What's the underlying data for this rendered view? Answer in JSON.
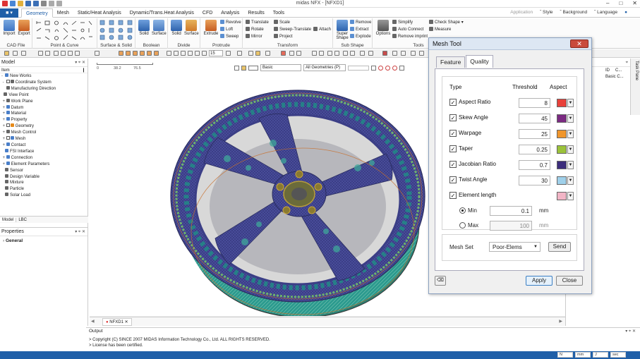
{
  "app": {
    "title": "midas NFX - [NFXD1]"
  },
  "menu": {
    "file_label": "■ ▾",
    "tabs": [
      "Geometry",
      "Mesh",
      "Static/Heat Analysis",
      "Dynamic/Trans.Heat Analysis",
      "CFD",
      "Analysis",
      "Results",
      "Tools"
    ],
    "right": [
      "Application",
      "ˇ Style",
      "ˇ Background",
      "ˇ Language",
      "ˇ"
    ]
  },
  "ribbon": {
    "groups": [
      {
        "label": "CAD File",
        "buttons": [
          "Import",
          "Export"
        ]
      },
      {
        "label": "Point & Curve",
        "buttons": []
      },
      {
        "label": "Surface & Solid",
        "buttons": []
      },
      {
        "label": "Boolean",
        "buttons": [
          "Solid",
          "Surface"
        ]
      },
      {
        "label": "Divide",
        "buttons": [
          "Solid",
          "Surface"
        ]
      },
      {
        "label": "Protrude",
        "buttons": [
          "Extrude"
        ],
        "small": [
          "Revolve",
          "Loft",
          "Sweep"
        ]
      },
      {
        "label": "Transform",
        "small": [
          "Translate",
          "Rotate",
          "Mirror",
          "Scale",
          "Sweep-Translate",
          "Project",
          "Attach"
        ]
      },
      {
        "label": "Sub Shape",
        "buttons": [
          "Super Shape"
        ],
        "small": [
          "Remove",
          "Extract",
          "Explode"
        ]
      },
      {
        "label": "Tools",
        "buttons": [
          "Options"
        ],
        "small": [
          "Simplify",
          "Auto Connect",
          "Remove imprint",
          "Check Shape ▾",
          "Measure"
        ]
      }
    ]
  },
  "toolbar2": {
    "zoom_value": "15"
  },
  "left_panel": {
    "title": "Model",
    "column": "Item",
    "tree": [
      {
        "label": "New Works",
        "color": "#4a7fc9"
      },
      {
        "label": "Coordinate System",
        "color": "#666"
      },
      {
        "label": "Manufacturing Direction",
        "color": "#666"
      },
      {
        "label": "View Point",
        "color": "#666"
      },
      {
        "label": "Work Plane",
        "color": "#666"
      },
      {
        "label": "Datum",
        "color": "#4a7fc9"
      },
      {
        "label": "Material",
        "color": "#4a7fc9"
      },
      {
        "label": "Property",
        "color": "#4a7fc9"
      },
      {
        "label": "Geometry",
        "color": "#e68a1a"
      },
      {
        "label": "Mesh Control",
        "color": "#666"
      },
      {
        "label": "Mesh",
        "color": "#4a7fc9"
      },
      {
        "label": "Contact",
        "color": "#4a7fc9"
      },
      {
        "label": "FSI Interface",
        "color": "#4a7fc9"
      },
      {
        "label": "Connection",
        "color": "#4a7fc9"
      },
      {
        "label": "Element Parameters",
        "color": "#4a7fc9"
      },
      {
        "label": "Sensor",
        "color": "#666"
      },
      {
        "label": "Design Variable",
        "color": "#666"
      },
      {
        "label": "Mixture",
        "color": "#666"
      },
      {
        "label": "Particle",
        "color": "#666"
      },
      {
        "label": "Solar Load",
        "color": "#666"
      }
    ],
    "tabs": [
      "Model",
      "LBC"
    ]
  },
  "properties": {
    "title": "Properties",
    "section": "General"
  },
  "viewport": {
    "ruler_ticks": [
      "0",
      "38.2",
      "76.5"
    ],
    "display_mode": "Basic",
    "filter": "All Geometries (P)",
    "doc_tab": "NFXD1"
  },
  "right_panel": {
    "header": "ults",
    "col1": "ID",
    "col2": "C...",
    "row1_col2": "Basic C..."
  },
  "task_pane": "Task Pane",
  "output": {
    "title": "Output",
    "lines": [
      "> Copyright (C) SINCE 2007 MIDAS Information Technology Co., Ltd. ALL RIGHTS RESERVED.",
      "> License has been certified."
    ]
  },
  "status": {
    "fields": [
      "N",
      "mm",
      "J",
      "sec"
    ]
  },
  "mesh_tool": {
    "title": "Mesh Tool",
    "close": "✕",
    "tabs": [
      "Feature",
      "Quality"
    ],
    "active_tab": "Quality",
    "headers": {
      "type": "Type",
      "threshold": "Threshold",
      "aspect": "Aspect"
    },
    "rows": [
      {
        "label": "Aspect Ratio",
        "checked": true,
        "threshold": "8",
        "color": "#e8413a"
      },
      {
        "label": "Skew Angle",
        "checked": true,
        "threshold": "45",
        "color": "#7b2a82"
      },
      {
        "label": "Warpage",
        "checked": true,
        "threshold": "25",
        "color": "#f0962c"
      },
      {
        "label": "Taper",
        "checked": true,
        "threshold": "0.25",
        "color": "#9bc23a"
      },
      {
        "label": "Jacobian Ratio",
        "checked": true,
        "threshold": "0.7",
        "color": "#3c2d7c"
      },
      {
        "label": "Twist Angle",
        "checked": true,
        "threshold": "30",
        "color": "#9fd0ea"
      },
      {
        "label": "Element length",
        "checked": true,
        "threshold": "",
        "color": "#f2b5c6"
      }
    ],
    "min_label": "Min",
    "min_value": "0.1",
    "min_unit": "mm",
    "max_label": "Max",
    "max_value": "100",
    "max_unit": "mm",
    "mesh_set_label": "Mesh Set",
    "mesh_set_value": "Poor-Elems",
    "send_label": "Send",
    "apply_label": "Apply",
    "close_label": "Close"
  }
}
